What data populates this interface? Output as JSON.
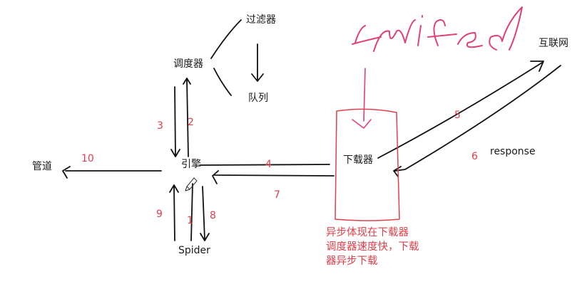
{
  "nodes": {
    "filter": "过滤器",
    "scheduler": "调度器",
    "queue": "队列",
    "engine": "引擎",
    "pipeline": "管道",
    "downloader": "下载器",
    "internet": "互联网",
    "spider": "Spider",
    "response": "response"
  },
  "flow_numbers": {
    "n1": "1",
    "n2": "2",
    "n3": "3",
    "n4": "4",
    "n5": "5",
    "n6": "6",
    "n7": "7",
    "n8": "8",
    "n9": "9",
    "n10": "10"
  },
  "note_lines": [
    "异步体现在下载器",
    "调度器速度快，下载",
    "器异步下载"
  ],
  "handwriting": "twisted",
  "colors": {
    "ink": "#1a1a1a",
    "red": "#e0404a",
    "magenta": "#e0407a"
  }
}
